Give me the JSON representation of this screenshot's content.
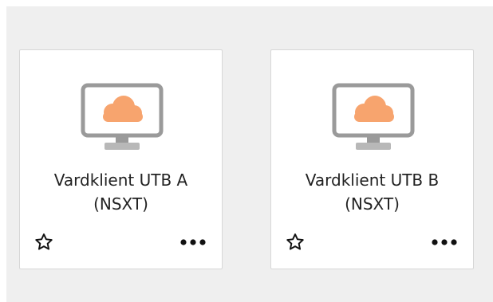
{
  "cards": [
    {
      "title_line1": "Vardklient UTB A",
      "title_line2": "(NSXT)",
      "icon": "cloud-desktop-icon",
      "favorite_icon": "star-outline-icon",
      "more_icon": "more-horizontal-icon"
    },
    {
      "title_line1": "Vardklient UTB B",
      "title_line2": "(NSXT)",
      "icon": "cloud-desktop-icon",
      "favorite_icon": "star-outline-icon",
      "more_icon": "more-horizontal-icon"
    }
  ],
  "colors": {
    "panel_background": "#efefef",
    "card_background": "#ffffff",
    "card_border": "#d7d7d7",
    "monitor_stroke": "#999999",
    "cloud_fill": "#f7a46e",
    "text": "#222222"
  }
}
